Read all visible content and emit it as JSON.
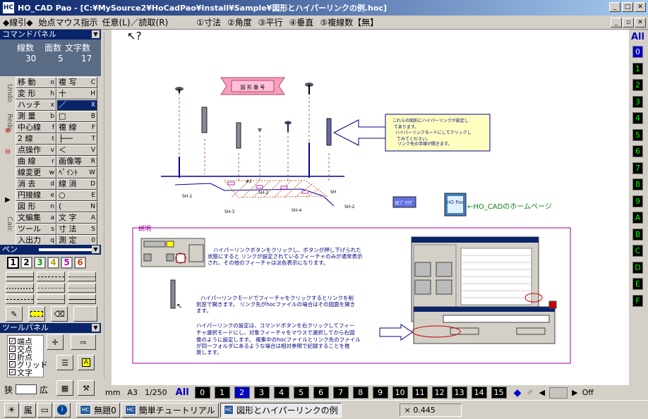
{
  "window": {
    "title": "HO_CAD Pao - [C:¥MySource2¥HoCadPao¥Install¥Sample¥図形とハイパーリンクの例.hoc]",
    "app_icon": "HC"
  },
  "modebar": {
    "items": [
      "◆線引◆",
      "始点マウス指示",
      "任意(L)／読取(R)",
      "①寸法",
      "②角度",
      "③平行",
      "④垂直",
      "⑤複線数【無】"
    ]
  },
  "command_panel": {
    "header": "コマンドパネル",
    "count_labels": [
      "線数",
      "面数",
      "文字数"
    ],
    "count_values": [
      "30",
      "5",
      "17"
    ],
    "side_tabs": [
      "Undo",
      "Redo",
      "Calc"
    ],
    "rows": [
      [
        {
          "l": "移 動",
          "k": "o"
        },
        {
          "l": "複 写",
          "k": "C"
        }
      ],
      [
        {
          "l": "変 形",
          "k": "h"
        },
        {
          "l": "十",
          "k": "H"
        }
      ],
      [
        {
          "l": "ハッチ",
          "k": "x"
        },
        {
          "l": "／",
          "k": "X",
          "sel": true
        }
      ],
      [
        {
          "l": "測 量",
          "k": "b"
        },
        {
          "l": "□",
          "k": "B"
        }
      ],
      [
        {
          "l": "中心線",
          "k": "f"
        },
        {
          "l": "複 線",
          "k": "F"
        }
      ],
      [
        {
          "l": "2 線",
          "k": "t"
        },
        {
          "l": "├──",
          "k": "T"
        }
      ],
      [
        {
          "l": "点操作",
          "k": "v"
        },
        {
          "l": "＜",
          "k": "V"
        }
      ],
      [
        {
          "l": "曲 線",
          "k": "r"
        },
        {
          "l": "画像等",
          "k": "R"
        }
      ],
      [
        {
          "l": "線変更",
          "k": "w"
        },
        {
          "l": "ﾍﾟｲﾝﾄ",
          "k": "W"
        }
      ],
      [
        {
          "l": "消 去",
          "k": "d"
        },
        {
          "l": "線 消",
          "k": "D"
        }
      ],
      [
        {
          "l": "円接線",
          "k": "e"
        },
        {
          "l": "○",
          "k": "E"
        }
      ],
      [
        {
          "l": "図 形",
          "k": "n"
        },
        {
          "l": "(",
          "k": "N"
        }
      ],
      [
        {
          "l": "文編集",
          "k": "a"
        },
        {
          "l": "文 字",
          "k": "A"
        }
      ],
      [
        {
          "l": "ツール",
          "k": "s"
        },
        {
          "l": "寸 法",
          "k": "S"
        }
      ],
      [
        {
          "l": "入出力",
          "k": "q"
        },
        {
          "l": "測 定",
          "k": "0"
        }
      ]
    ]
  },
  "pen_panel": {
    "header": "ペン",
    "pens": [
      "1",
      "2",
      "3",
      "4",
      "5",
      "6"
    ],
    "pen_colors": [
      "#000000",
      "#000000",
      "#00a000",
      "#c0a000",
      "#c000c0",
      "#d04000"
    ]
  },
  "tool_panel": {
    "header": "ツールパネル",
    "checks": [
      "端点",
      "交点",
      "折点",
      "グリッド",
      "文字"
    ],
    "narrow": "狭",
    "wide": "広"
  },
  "right_layers": {
    "all": "All",
    "layers": [
      "0",
      "1",
      "2",
      "3",
      "4",
      "5",
      "6",
      "7",
      "8",
      "9",
      "A",
      "B",
      "C",
      "D",
      "E",
      "F"
    ]
  },
  "bottombar": {
    "unit": "mm",
    "paper": "A3",
    "scale": "1/250",
    "all": "All",
    "pens": [
      "0",
      "1",
      "2",
      "3",
      "4",
      "5",
      "6",
      "7",
      "8",
      "9",
      "10",
      "11",
      "12",
      "13",
      "14",
      "15"
    ],
    "off": "Off"
  },
  "taskbar": {
    "tabs": [
      "無題0",
      "簡単チュートリアル",
      "図形とハイパーリンクの例"
    ],
    "active": 2,
    "status": "× 0.445"
  },
  "drawing": {
    "callout_lines": [
      "これらの図形にハイパーリンクが設定し",
      "てあります。",
      "ハイパーリンクモードにしてクリックし",
      "てみてください。",
      "リンク先の手順が開きます。"
    ],
    "banner": "図 形 番 号",
    "labels": [
      "#2",
      "SH-1",
      "SH-2",
      "SH-3",
      "SH",
      "SH-4",
      "SH-2"
    ],
    "ie_button": "IEﾌﾞﾗｳｻﾞ",
    "homepage_link": "←HO_CADのホームページ",
    "homepage_icon": "HO Pao",
    "explain_title": "説明",
    "para1": [
      "ハイパーリンクボタンをクリックし、ボタンが押し下げられた",
      "状態にすると リンクが設定されているフィーチャのみが通常表示",
      "され、その他のフィーチャは淡色表示になります。"
    ],
    "para2": [
      "ハイパーリンクモードでフィーチャをクリックするとリンクを削",
      "別窓で開きます。 リンク先がhocファイルの場合はその図面を開き",
      "ます。"
    ],
    "para3": [
      "ハイパーリンクの設定は、コマンドボタンを右クリックしてフィー",
      "チャ選択モードにし、対象フィーチャをマウスで選択してから右図",
      "像のように設定します。 複集中のhocファイルとリンク先のファイル",
      "が同一フォルダにあるような場合は相対参照で記録することを推",
      "奨します。"
    ]
  }
}
